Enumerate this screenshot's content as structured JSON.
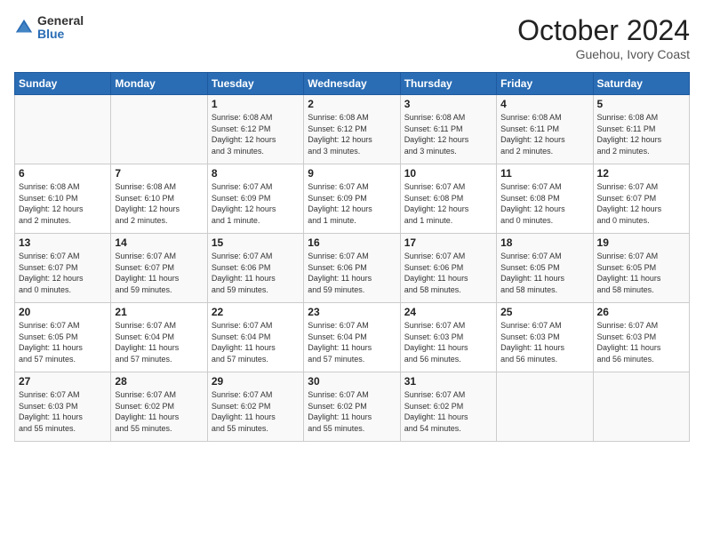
{
  "header": {
    "logo_general": "General",
    "logo_blue": "Blue",
    "month": "October 2024",
    "location": "Guehou, Ivory Coast"
  },
  "days_of_week": [
    "Sunday",
    "Monday",
    "Tuesday",
    "Wednesday",
    "Thursday",
    "Friday",
    "Saturday"
  ],
  "weeks": [
    [
      {
        "day": "",
        "info": ""
      },
      {
        "day": "",
        "info": ""
      },
      {
        "day": "1",
        "info": "Sunrise: 6:08 AM\nSunset: 6:12 PM\nDaylight: 12 hours\nand 3 minutes."
      },
      {
        "day": "2",
        "info": "Sunrise: 6:08 AM\nSunset: 6:12 PM\nDaylight: 12 hours\nand 3 minutes."
      },
      {
        "day": "3",
        "info": "Sunrise: 6:08 AM\nSunset: 6:11 PM\nDaylight: 12 hours\nand 3 minutes."
      },
      {
        "day": "4",
        "info": "Sunrise: 6:08 AM\nSunset: 6:11 PM\nDaylight: 12 hours\nand 2 minutes."
      },
      {
        "day": "5",
        "info": "Sunrise: 6:08 AM\nSunset: 6:11 PM\nDaylight: 12 hours\nand 2 minutes."
      }
    ],
    [
      {
        "day": "6",
        "info": "Sunrise: 6:08 AM\nSunset: 6:10 PM\nDaylight: 12 hours\nand 2 minutes."
      },
      {
        "day": "7",
        "info": "Sunrise: 6:08 AM\nSunset: 6:10 PM\nDaylight: 12 hours\nand 2 minutes."
      },
      {
        "day": "8",
        "info": "Sunrise: 6:07 AM\nSunset: 6:09 PM\nDaylight: 12 hours\nand 1 minute."
      },
      {
        "day": "9",
        "info": "Sunrise: 6:07 AM\nSunset: 6:09 PM\nDaylight: 12 hours\nand 1 minute."
      },
      {
        "day": "10",
        "info": "Sunrise: 6:07 AM\nSunset: 6:08 PM\nDaylight: 12 hours\nand 1 minute."
      },
      {
        "day": "11",
        "info": "Sunrise: 6:07 AM\nSunset: 6:08 PM\nDaylight: 12 hours\nand 0 minutes."
      },
      {
        "day": "12",
        "info": "Sunrise: 6:07 AM\nSunset: 6:07 PM\nDaylight: 12 hours\nand 0 minutes."
      }
    ],
    [
      {
        "day": "13",
        "info": "Sunrise: 6:07 AM\nSunset: 6:07 PM\nDaylight: 12 hours\nand 0 minutes."
      },
      {
        "day": "14",
        "info": "Sunrise: 6:07 AM\nSunset: 6:07 PM\nDaylight: 11 hours\nand 59 minutes."
      },
      {
        "day": "15",
        "info": "Sunrise: 6:07 AM\nSunset: 6:06 PM\nDaylight: 11 hours\nand 59 minutes."
      },
      {
        "day": "16",
        "info": "Sunrise: 6:07 AM\nSunset: 6:06 PM\nDaylight: 11 hours\nand 59 minutes."
      },
      {
        "day": "17",
        "info": "Sunrise: 6:07 AM\nSunset: 6:06 PM\nDaylight: 11 hours\nand 58 minutes."
      },
      {
        "day": "18",
        "info": "Sunrise: 6:07 AM\nSunset: 6:05 PM\nDaylight: 11 hours\nand 58 minutes."
      },
      {
        "day": "19",
        "info": "Sunrise: 6:07 AM\nSunset: 6:05 PM\nDaylight: 11 hours\nand 58 minutes."
      }
    ],
    [
      {
        "day": "20",
        "info": "Sunrise: 6:07 AM\nSunset: 6:05 PM\nDaylight: 11 hours\nand 57 minutes."
      },
      {
        "day": "21",
        "info": "Sunrise: 6:07 AM\nSunset: 6:04 PM\nDaylight: 11 hours\nand 57 minutes."
      },
      {
        "day": "22",
        "info": "Sunrise: 6:07 AM\nSunset: 6:04 PM\nDaylight: 11 hours\nand 57 minutes."
      },
      {
        "day": "23",
        "info": "Sunrise: 6:07 AM\nSunset: 6:04 PM\nDaylight: 11 hours\nand 57 minutes."
      },
      {
        "day": "24",
        "info": "Sunrise: 6:07 AM\nSunset: 6:03 PM\nDaylight: 11 hours\nand 56 minutes."
      },
      {
        "day": "25",
        "info": "Sunrise: 6:07 AM\nSunset: 6:03 PM\nDaylight: 11 hours\nand 56 minutes."
      },
      {
        "day": "26",
        "info": "Sunrise: 6:07 AM\nSunset: 6:03 PM\nDaylight: 11 hours\nand 56 minutes."
      }
    ],
    [
      {
        "day": "27",
        "info": "Sunrise: 6:07 AM\nSunset: 6:03 PM\nDaylight: 11 hours\nand 55 minutes."
      },
      {
        "day": "28",
        "info": "Sunrise: 6:07 AM\nSunset: 6:02 PM\nDaylight: 11 hours\nand 55 minutes."
      },
      {
        "day": "29",
        "info": "Sunrise: 6:07 AM\nSunset: 6:02 PM\nDaylight: 11 hours\nand 55 minutes."
      },
      {
        "day": "30",
        "info": "Sunrise: 6:07 AM\nSunset: 6:02 PM\nDaylight: 11 hours\nand 55 minutes."
      },
      {
        "day": "31",
        "info": "Sunrise: 6:07 AM\nSunset: 6:02 PM\nDaylight: 11 hours\nand 54 minutes."
      },
      {
        "day": "",
        "info": ""
      },
      {
        "day": "",
        "info": ""
      }
    ]
  ]
}
